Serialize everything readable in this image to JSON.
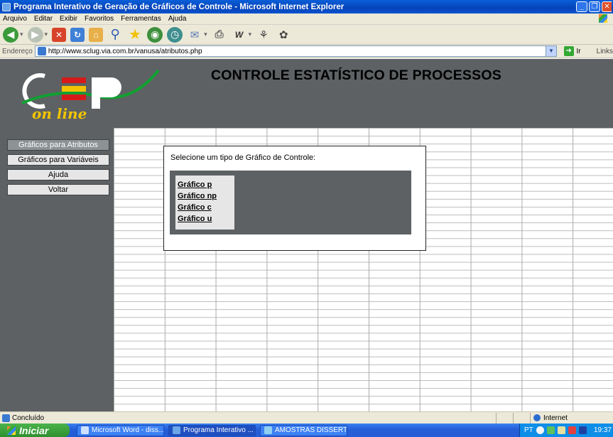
{
  "window": {
    "title": "Programa Interativo de Geração de Gráficos de Controle - Microsoft Internet Explorer",
    "buttons": [
      "minimize",
      "restore",
      "close"
    ]
  },
  "menu": [
    "Arquivo",
    "Editar",
    "Exibir",
    "Favoritos",
    "Ferramentas",
    "Ajuda"
  ],
  "address": {
    "label": "Endereço",
    "url": "http://www.sclug.via.com.br/vanusa/atributos.php",
    "go_label": "Ir",
    "links_label": "Links"
  },
  "page": {
    "site_title": "CONTROLE ESTATÍSTICO DE PROCESSOS",
    "logo": {
      "text": "on line",
      "letters": "CEP"
    },
    "nav": [
      {
        "label": "Gráficos para Atributos",
        "active": true
      },
      {
        "label": "Gráficos para Variáveis",
        "active": false
      },
      {
        "label": "Ajuda",
        "active": false
      },
      {
        "label": "Voltar",
        "active": false
      }
    ],
    "prompt": "Selecione um tipo de Gráfico de Controle:",
    "chart_links": [
      "Gráfico p",
      "Gráfico np",
      "Gráfico c",
      "Gráfico u"
    ]
  },
  "status": {
    "text": "Concluído",
    "zone": "Internet"
  },
  "taskbar": {
    "start_label": "Iniciar",
    "tasks": [
      {
        "label": "Microsoft Word - diss...",
        "active": false
      },
      {
        "label": "Programa Interativo ...",
        "active": true
      },
      {
        "label": "AMOSTRAS DISSERT...",
        "active": false
      }
    ],
    "language": "PT",
    "clock": "19:37"
  },
  "colors": {
    "page_gray": "#5d6163",
    "button_gray": "#e6e6e6",
    "active_nav": "#8d9295",
    "xp_blue": "#245cd4",
    "logo_yellow": "#f2c400",
    "logo_red": "#d61a1a",
    "logo_green": "#11a032"
  }
}
